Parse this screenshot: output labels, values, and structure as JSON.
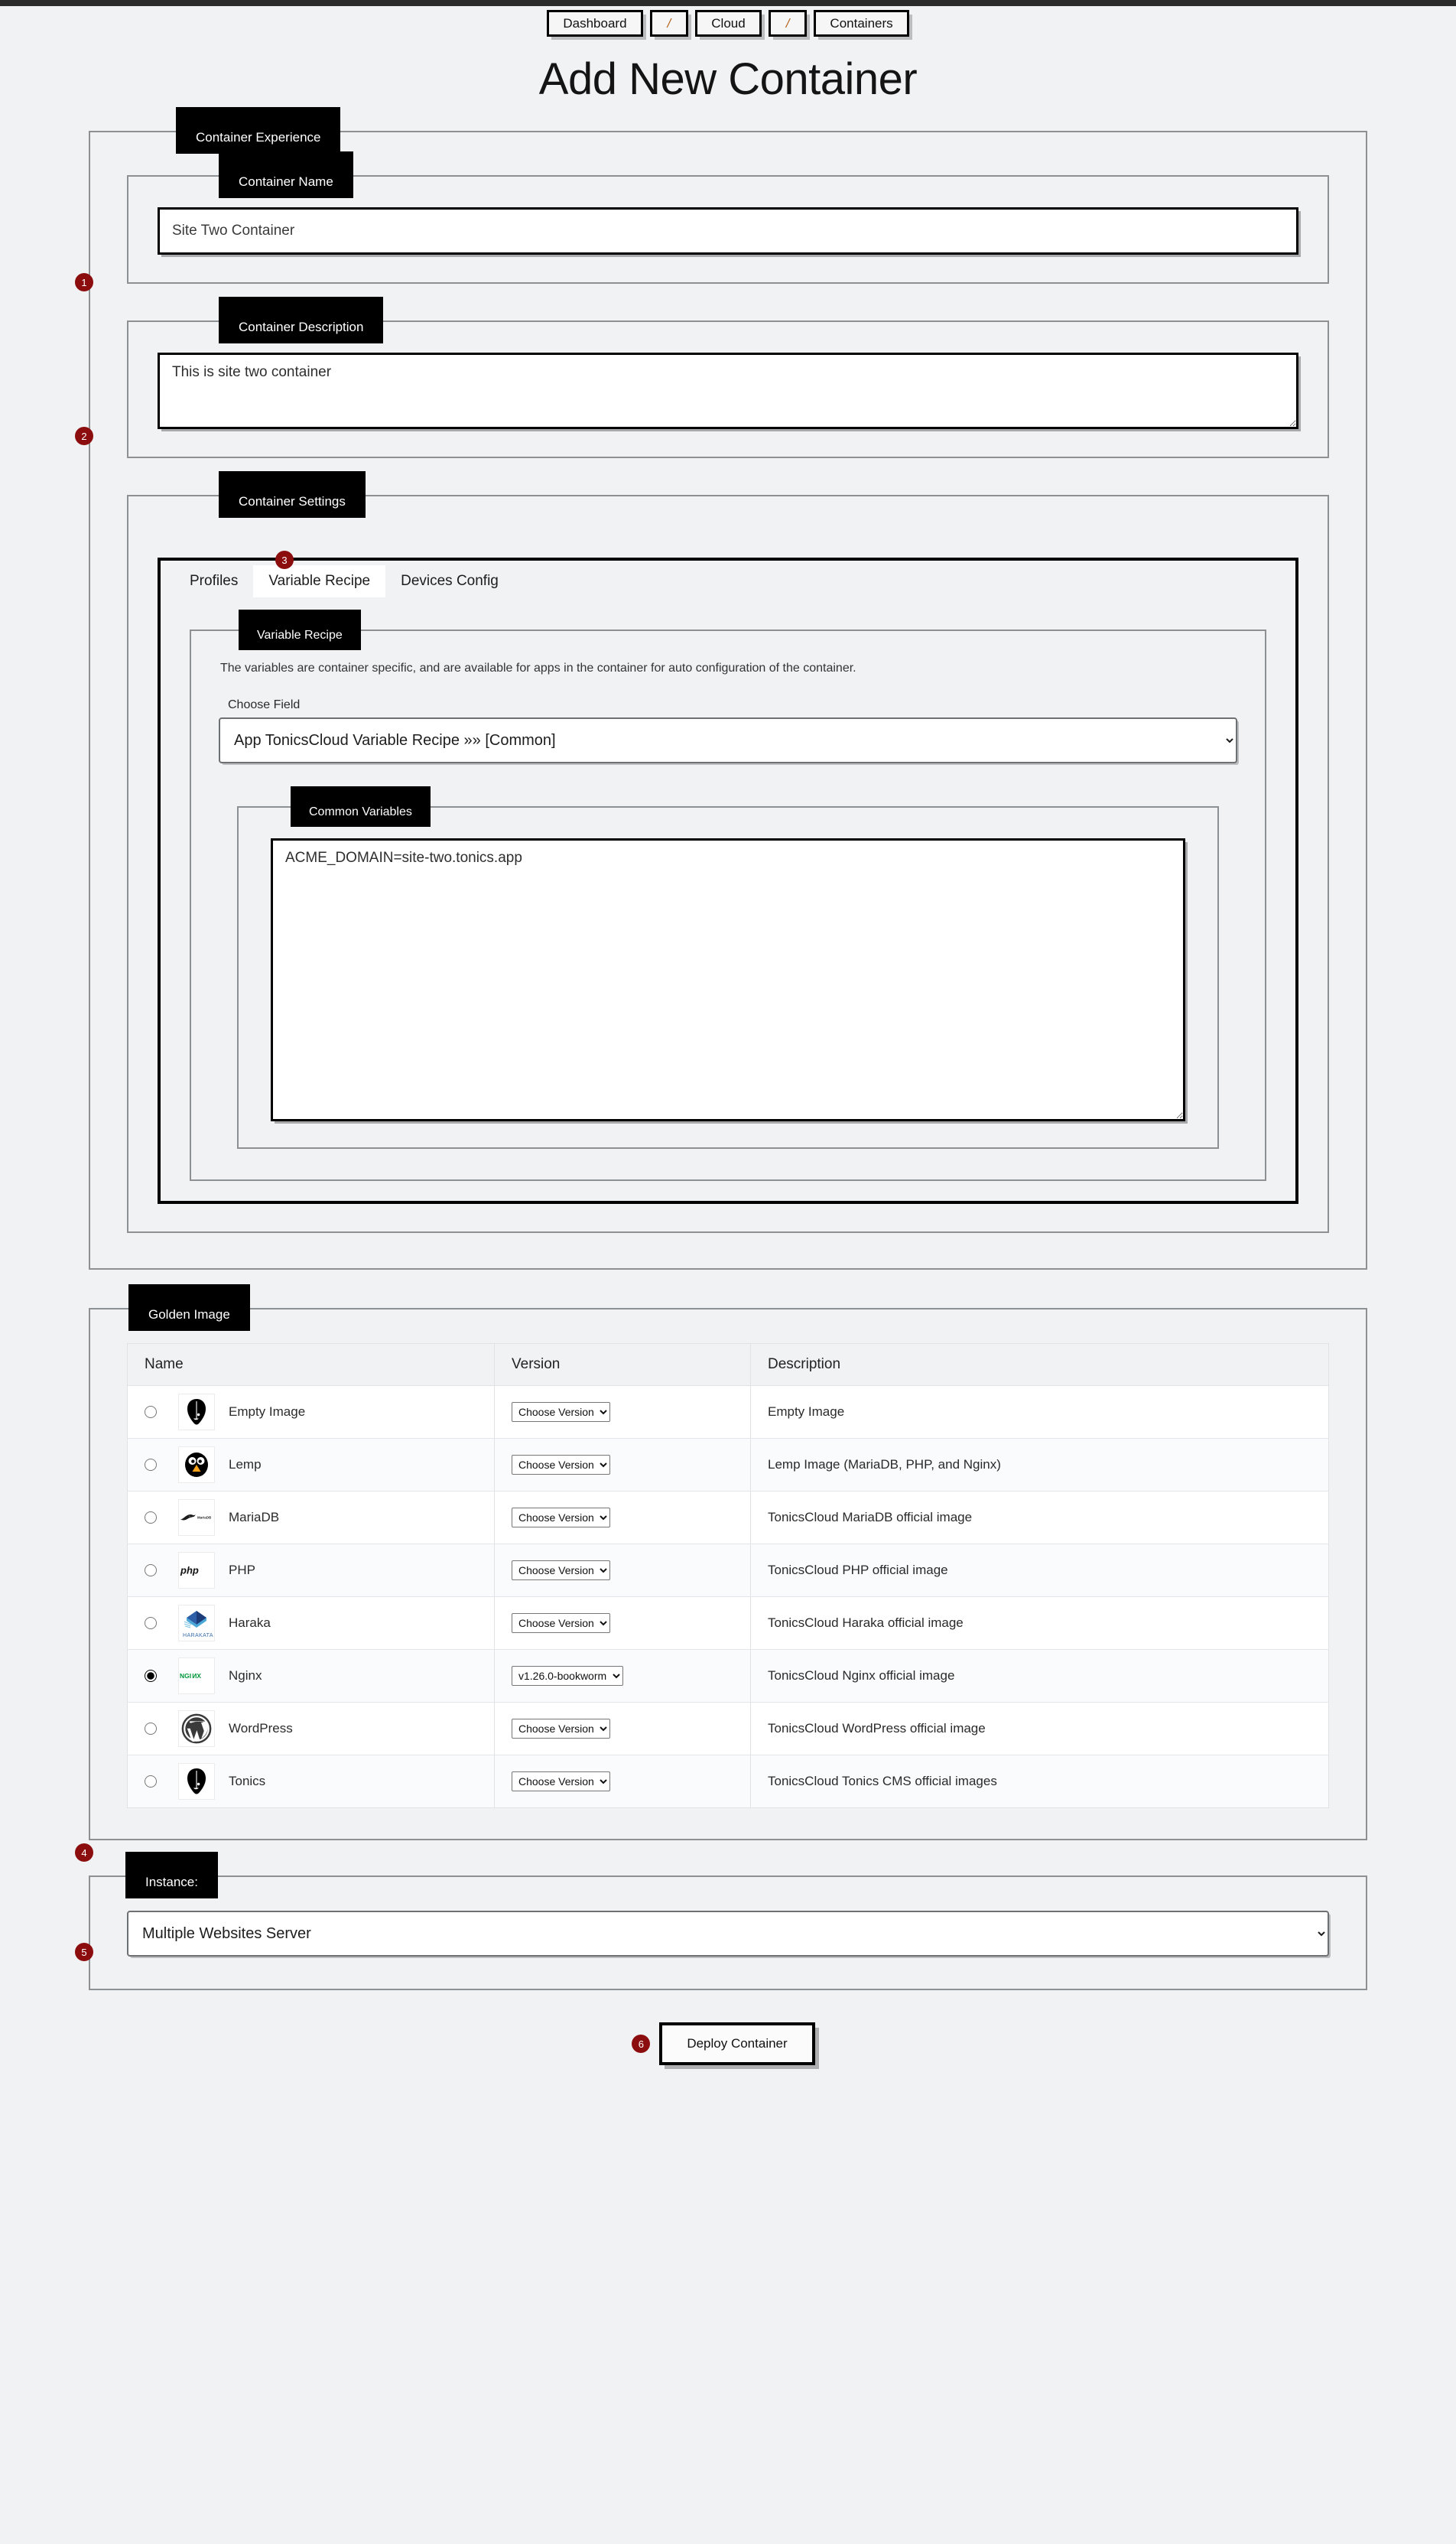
{
  "breadcrumb": {
    "items": [
      {
        "label": "Dashboard",
        "type": "link"
      },
      {
        "label": "/",
        "type": "sep"
      },
      {
        "label": "Cloud",
        "type": "link"
      },
      {
        "label": "/",
        "type": "sep"
      },
      {
        "label": "Containers",
        "type": "link"
      }
    ]
  },
  "page": {
    "title": "Add New Container"
  },
  "experience": {
    "legend": "Container Experience"
  },
  "container_name": {
    "legend": "Container Name",
    "value": "Site Two Container",
    "placeholder": "Container Name"
  },
  "container_description": {
    "legend": "Container Description",
    "value": "This is site two container",
    "placeholder": "Container Description"
  },
  "container_settings": {
    "legend": "Container Settings",
    "tabs": [
      {
        "label": "Profiles",
        "active": false
      },
      {
        "label": "Variable Recipe",
        "active": true
      },
      {
        "label": "Devices Config",
        "active": false
      }
    ]
  },
  "variable_recipe": {
    "legend": "Variable Recipe",
    "note": "The variables are container specific, and are available for apps in the container for auto configuration of the container.",
    "choose_field_label": "Choose Field",
    "choose_field_value": "App TonicsCloud Variable Recipe »» [Common]",
    "common_legend": "Common Variables",
    "common_value": "ACME_DOMAIN=site-two.tonics.app",
    "common_placeholder": "Common Variables"
  },
  "golden_image": {
    "legend": "Golden Image",
    "columns": [
      "Name",
      "Version",
      "Description"
    ],
    "choose_version_label": "Choose Version",
    "rows": [
      {
        "name": "Empty Image",
        "icon": "tonics-mask-icon",
        "version": "Choose Version",
        "description": "Empty Image",
        "selected": false
      },
      {
        "name": "Lemp",
        "icon": "penguin-icon",
        "version": "Choose Version",
        "description": "Lemp Image (MariaDB, PHP, and Nginx)",
        "selected": false
      },
      {
        "name": "MariaDB",
        "icon": "mariadb-seal-icon",
        "version": "Choose Version",
        "description": "TonicsCloud MariaDB official image",
        "selected": false
      },
      {
        "name": "PHP",
        "icon": "php-icon",
        "version": "Choose Version",
        "description": "TonicsCloud PHP official image",
        "selected": false
      },
      {
        "name": "Haraka",
        "icon": "haraka-icon",
        "version": "Choose Version",
        "description": "TonicsCloud Haraka official image",
        "selected": false
      },
      {
        "name": "Nginx",
        "icon": "nginx-icon",
        "version": "v1.26.0-bookworm",
        "description": "TonicsCloud Nginx official image",
        "selected": true
      },
      {
        "name": "WordPress",
        "icon": "wordpress-icon",
        "version": "Choose Version",
        "description": "TonicsCloud WordPress official image",
        "selected": false
      },
      {
        "name": "Tonics",
        "icon": "tonics-mask-icon",
        "version": "Choose Version",
        "description": "TonicsCloud Tonics CMS official images",
        "selected": false
      }
    ]
  },
  "instance": {
    "legend": "Instance:",
    "value": "Multiple Websites Server"
  },
  "deploy": {
    "label": "Deploy Container"
  },
  "steps": [
    {
      "number": "1"
    },
    {
      "number": "2"
    },
    {
      "number": "3"
    },
    {
      "number": "4"
    },
    {
      "number": "5"
    },
    {
      "number": "6"
    }
  ],
  "colors": {
    "badge": "#8b0d0d",
    "legend_bg": "#000000",
    "page_bg": "#f1f2f4",
    "nginx_green": "#009639"
  }
}
